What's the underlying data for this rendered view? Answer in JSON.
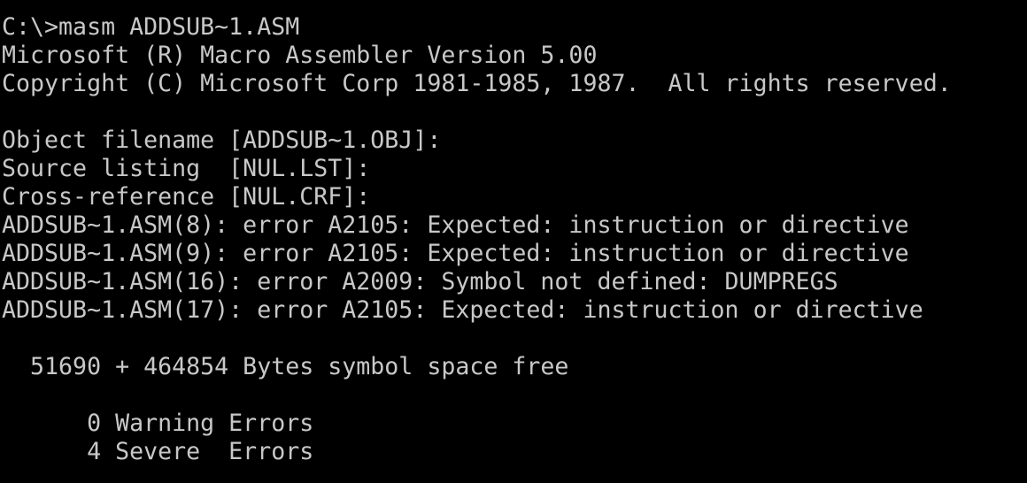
{
  "terminal": {
    "background_color": "#000000",
    "text_color": "#c8c8c8",
    "lines": [
      "C:\\>masm ADDSUB~1.ASM",
      "Microsoft (R) Macro Assembler Version 5.00",
      "Copyright (C) Microsoft Corp 1981-1985, 1987.  All rights reserved.",
      "",
      "Object filename [ADDSUB~1.OBJ]:",
      "Source listing  [NUL.LST]:",
      "Cross-reference [NUL.CRF]:",
      "ADDSUB~1.ASM(8): error A2105: Expected: instruction or directive",
      "ADDSUB~1.ASM(9): error A2105: Expected: instruction or directive",
      "ADDSUB~1.ASM(16): error A2009: Symbol not defined: DUMPREGS",
      "ADDSUB~1.ASM(17): error A2105: Expected: instruction or directive",
      "",
      "  51690 + 464854 Bytes symbol space free",
      "",
      "      0 Warning Errors",
      "      4 Severe  Errors"
    ]
  }
}
